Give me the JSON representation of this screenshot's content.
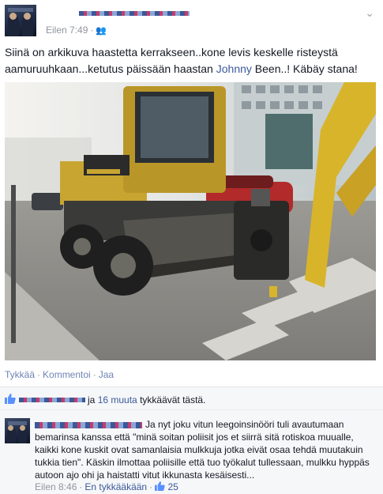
{
  "post": {
    "time": "Eilen 7:49",
    "dot": "·",
    "text_before_link": "Siinä on arkikuva haastetta kerrakseen..kone levis keskelle risteystä aamuruuhkaan...ketutus päissään haastan ",
    "link": "Johnny",
    "text_after_link": " Been..! Käbäy stana!"
  },
  "actions": {
    "like": "Tykkää",
    "comment": "Kommentoi",
    "share": "Jaa",
    "sep": "·"
  },
  "likes": {
    "connector": "ja ",
    "others_link": "16 muuta",
    "suffix": " tykkäävät tästä."
  },
  "comment": {
    "text": "Ja nyt joku vitun leegoinsinööri tuli avautumaan bemarinsa kanssa että \"minä soitan poliisit jos et siirrä sitä rotiskoa muualle, kaikki kone kuskit ovat samanlaisia mulkkuja jotka eivät osaa tehdä muutakuin tukkia tien\". Käskin ilmottaa poliisille että tuo työkalut tullessaan, mulkku hyppäs autoon ajo ohi ja haistatti vitut ikkunasta kesäisesti...",
    "time": "Eilen 8:46",
    "dot": "·",
    "unlike": "En tykkääkään",
    "like_count": "25"
  },
  "colors": {
    "link": "#3b5998",
    "action_link": "#6d84b4",
    "meta": "#90949c",
    "likebar_bg": "#f6f7f9"
  }
}
